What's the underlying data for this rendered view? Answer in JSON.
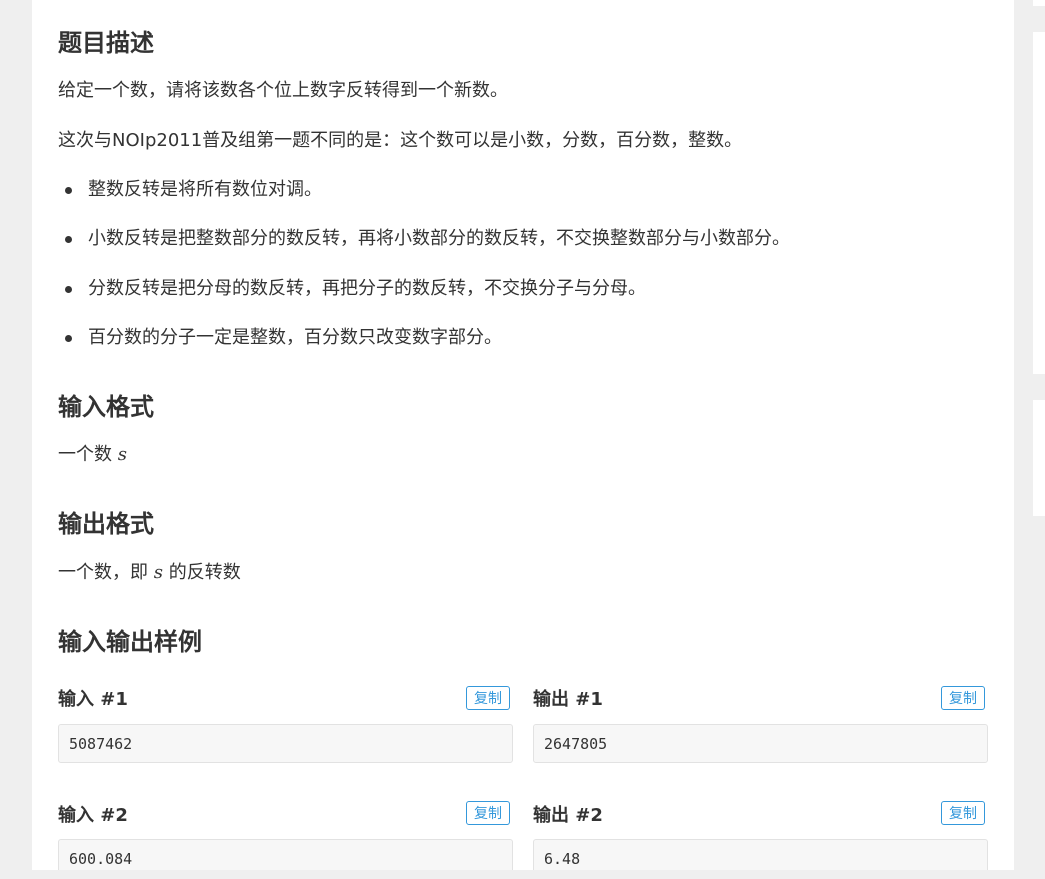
{
  "description": {
    "heading": "题目描述",
    "para1": "给定一个数，请将该数各个位上数字反转得到一个新数。",
    "para2": "这次与NOIp2011普及组第一题不同的是：这个数可以是小数，分数，百分数，整数。",
    "bullets": [
      "整数反转是将所有数位对调。",
      "小数反转是把整数部分的数反转，再将小数部分的数反转，不交换整数部分与小数部分。",
      "分数反转是把分母的数反转，再把分子的数反转，不交换分子与分母。",
      "百分数的分子一定是整数，百分数只改变数字部分。"
    ]
  },
  "input_format": {
    "heading": "输入格式",
    "text_before": "一个数 ",
    "var": "s"
  },
  "output_format": {
    "heading": "输出格式",
    "text_before": "一个数，即 ",
    "var": "s",
    "text_after": " 的反转数"
  },
  "samples": {
    "heading": "输入输出样例",
    "copy_label": "复制",
    "items": [
      {
        "input_title": "输入 #1",
        "input": "5087462",
        "output_title": "输出 #1",
        "output": "2647805"
      },
      {
        "input_title": "输入 #2",
        "input": "600.084",
        "output_title": "输出 #2",
        "output": "6.48"
      }
    ]
  },
  "colors": {
    "accent": "#3498db",
    "background": "#efefef",
    "card": "#ffffff",
    "text": "#333333"
  }
}
